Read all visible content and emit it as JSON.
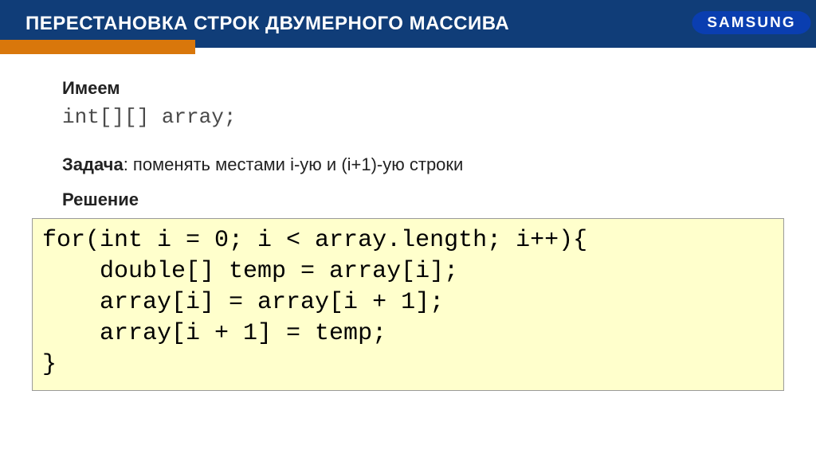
{
  "header": {
    "title": "ПЕРЕСТАНОВКА СТРОК ДВУМЕРНОГО МАССИВА",
    "brand": "SAMSUNG"
  },
  "content": {
    "have_label": "Имеем",
    "declaration": "int[][] array;",
    "task_label": "Задача",
    "task_text": ": поменять местами i-ую и (i+1)-ую строки",
    "solution_label": "Решение"
  },
  "code": "for(int i = 0; i < array.length; i++){\n    double[] temp = array[i];\n    array[i] = array[i + 1];\n    array[i + 1] = temp;\n}"
}
